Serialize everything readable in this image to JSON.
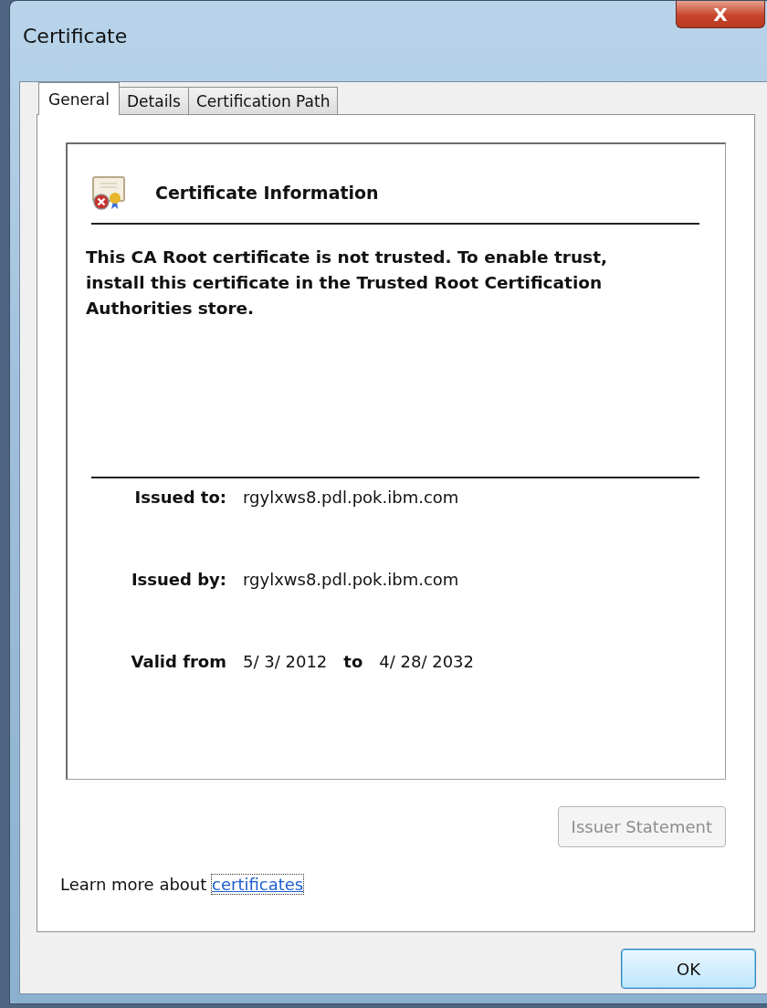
{
  "window": {
    "title": "Certificate",
    "close": "X"
  },
  "tabs": [
    {
      "label": "General",
      "selected": true
    },
    {
      "label": "Details",
      "selected": false
    },
    {
      "label": "Certification Path",
      "selected": false
    }
  ],
  "info": {
    "heading": "Certificate Information",
    "trusted": false,
    "message": "This CA Root certificate is not trusted. To enable trust, install this certificate in the Trusted Root Certification Authorities store.",
    "issued_to": {
      "label": "Issued to:",
      "value": "rgylxws8.pdl.pok.ibm.com"
    },
    "issued_by": {
      "label": "Issued by:",
      "value": "rgylxws8.pdl.pok.ibm.com"
    },
    "validity": {
      "label": "Valid from",
      "from": "5/ 3/ 2012",
      "to_label": "to",
      "to": "4/ 28/ 2032"
    }
  },
  "issuer_statement": {
    "label": "Issuer Statement",
    "disabled": true
  },
  "learn_more": {
    "text": "Learn more about",
    "link": "certificates"
  },
  "buttons": [
    {
      "label": "OK"
    }
  ]
}
